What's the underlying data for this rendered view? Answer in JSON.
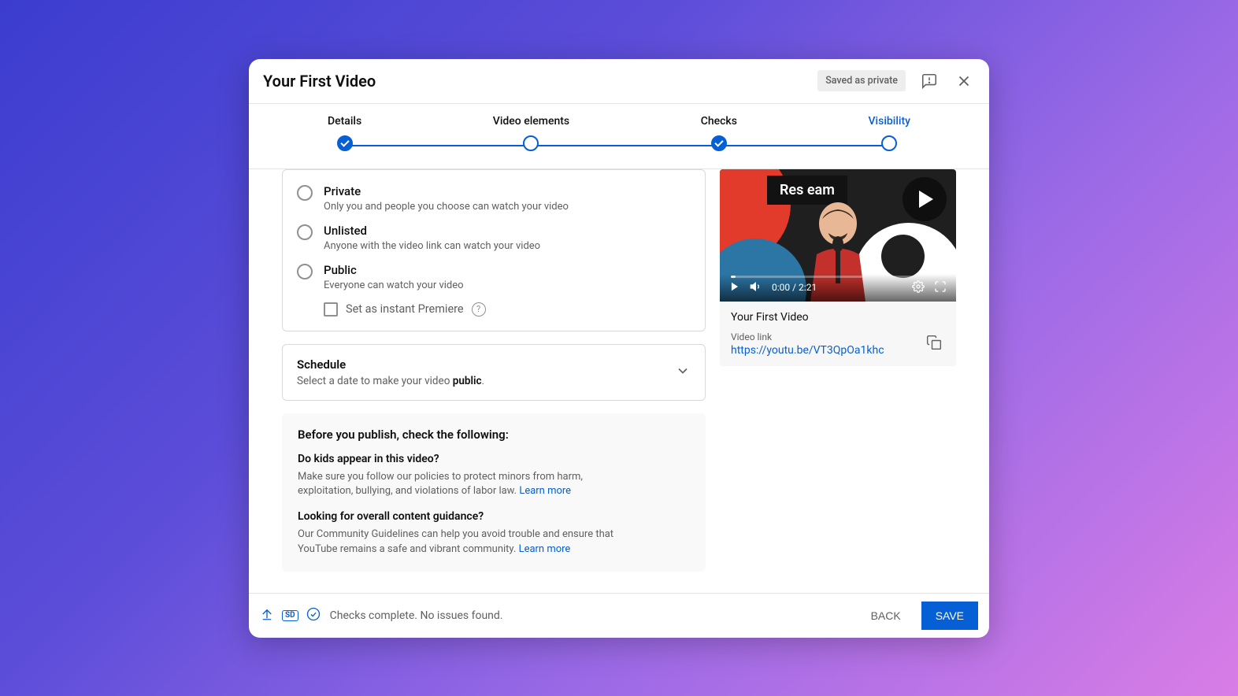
{
  "header": {
    "title": "Your First Video",
    "saved_chip": "Saved as private"
  },
  "stepper": {
    "steps": [
      "Details",
      "Video elements",
      "Checks",
      "Visibility"
    ]
  },
  "visibility": {
    "private": {
      "title": "Private",
      "desc": "Only you and people you choose can watch your video"
    },
    "unlisted": {
      "title": "Unlisted",
      "desc": "Anyone with the video link can watch your video"
    },
    "public": {
      "title": "Public",
      "desc": "Everyone can watch your video"
    },
    "premiere": {
      "label": "Set as instant Premiere"
    }
  },
  "schedule": {
    "title": "Schedule",
    "desc_prefix": "Select a date to make your video ",
    "desc_bold": "public",
    "desc_suffix": "."
  },
  "notice": {
    "heading": "Before you publish, check the following:",
    "kids_q": "Do kids appear in this video?",
    "kids_p": "Make sure you follow our policies to protect minors from harm, exploitation, bullying, and violations of labor law. ",
    "guidance_q": "Looking for overall content guidance?",
    "guidance_p": "Our Community Guidelines can help you avoid trouble and ensure that YouTube remains a safe and vibrant community. ",
    "learn_more": "Learn more"
  },
  "preview": {
    "banner": "Res   eam",
    "time": "0:00 / 2:21",
    "title": "Your First Video",
    "link_label": "Video link",
    "link": "https://youtu.be/VT3QpOa1khc"
  },
  "footer": {
    "status": "Checks complete. No issues found.",
    "back": "BACK",
    "save": "SAVE"
  }
}
